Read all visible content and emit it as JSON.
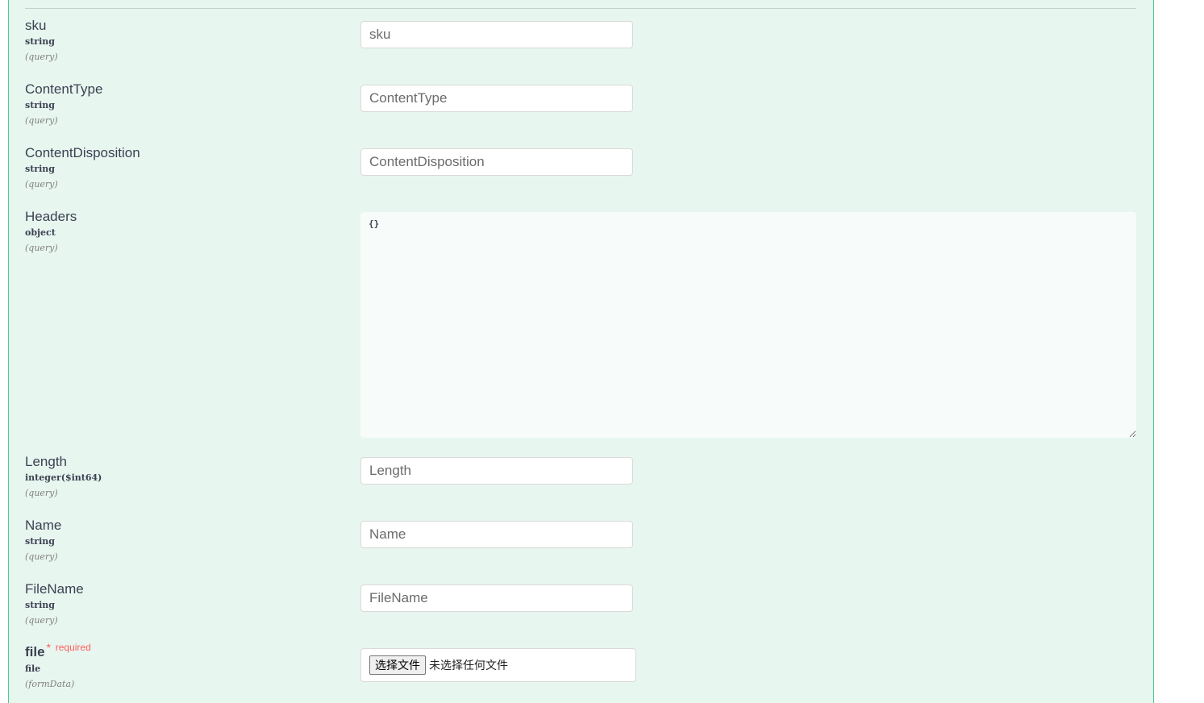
{
  "parameters": [
    {
      "name": "sku",
      "type": "string",
      "in": "(query)",
      "placeholder": "sku"
    },
    {
      "name": "ContentType",
      "type": "string",
      "in": "(query)",
      "placeholder": "ContentType"
    },
    {
      "name": "ContentDisposition",
      "type": "string",
      "in": "(query)",
      "placeholder": "ContentDisposition"
    },
    {
      "name": "Headers",
      "type": "object",
      "in": "(query)",
      "value": "{}"
    },
    {
      "name": "Length",
      "type": "integer($int64)",
      "in": "(query)",
      "placeholder": "Length"
    },
    {
      "name": "Name",
      "type": "string",
      "in": "(query)",
      "placeholder": "Name"
    },
    {
      "name": "FileName",
      "type": "string",
      "in": "(query)",
      "placeholder": "FileName"
    },
    {
      "name": "file",
      "type": "file",
      "in": "(formData)",
      "required_mark": "*",
      "required_label": "required",
      "button_label": "选择文件",
      "status_text": "未选择任何文件"
    }
  ],
  "colors": {
    "panel_bg": "#e8f6f0",
    "panel_border": "#49cc90",
    "required": "#ff6060"
  }
}
